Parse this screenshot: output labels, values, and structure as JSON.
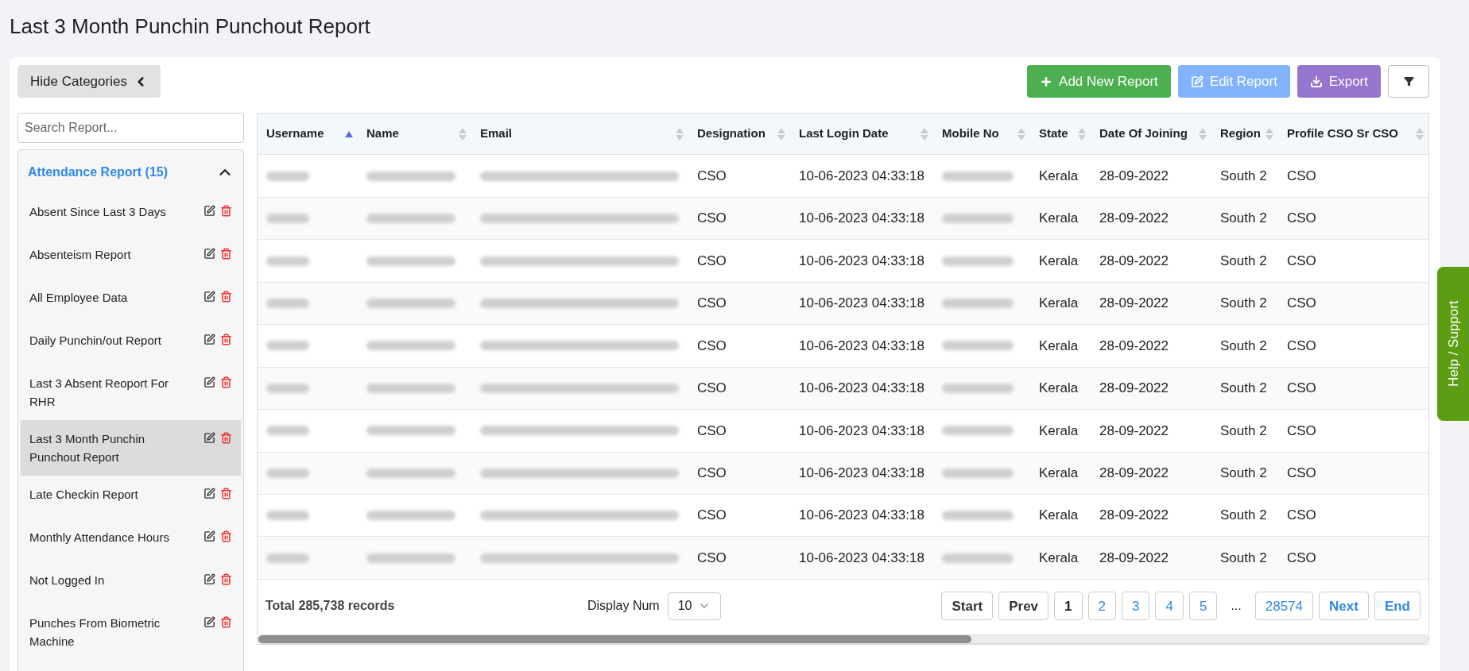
{
  "page_title": "Last 3 Month Punchin Punchout Report",
  "hide_categories_button": "Hide Categories",
  "toolbar": [
    {
      "kind": "add",
      "label": "Add New Report"
    },
    {
      "kind": "edit",
      "label": "Edit Report"
    },
    {
      "kind": "export",
      "label": "Export"
    },
    {
      "kind": "filter"
    }
  ],
  "sidebar": {
    "search_placeholder": "Search Report...",
    "category": {
      "title": "Attendance Report (15)",
      "expanded": true
    },
    "items": [
      {
        "label": "Absent Since Last 3 Days",
        "selected": false
      },
      {
        "label": "Absenteism Report",
        "selected": false
      },
      {
        "label": "All Employee Data",
        "selected": false
      },
      {
        "label": "Daily Punchin/out Report",
        "selected": false
      },
      {
        "label": "Last 3 Absent Reoport For RHR",
        "selected": false
      },
      {
        "label": "Last 3 Month Punchin Punchout Report",
        "selected": true
      },
      {
        "label": "Late Checkin Report",
        "selected": false
      },
      {
        "label": "Monthly Attendance Hours",
        "selected": false
      },
      {
        "label": "Not Logged In",
        "selected": false
      },
      {
        "label": "Punches From Biometric Machine",
        "selected": false
      }
    ]
  },
  "table": {
    "columns": [
      {
        "label": "Username",
        "sorted": true
      },
      {
        "label": "Name",
        "sorted": false
      },
      {
        "label": "Email",
        "sorted": false
      },
      {
        "label": "Designation",
        "sorted": false
      },
      {
        "label": "Last Login Date",
        "sorted": false
      },
      {
        "label": "Mobile No",
        "sorted": false
      },
      {
        "label": "State",
        "sorted": false
      },
      {
        "label": "Date Of Joining",
        "sorted": false
      },
      {
        "label": "Region",
        "sorted": false
      },
      {
        "label": "Profile CSO Sr CSO",
        "sorted": false
      }
    ],
    "rows": [
      {
        "cells": [
          {
            "kind": "blurred"
          },
          {
            "kind": "blurred"
          },
          {
            "kind": "blurred"
          },
          {
            "kind": "text",
            "text": "CSO"
          },
          {
            "kind": "text",
            "text": "10-06-2023 04:33:18"
          },
          {
            "kind": "blurred"
          },
          {
            "kind": "text",
            "text": "Kerala"
          },
          {
            "kind": "text",
            "text": "28-09-2022"
          },
          {
            "kind": "text",
            "text": "South 2"
          },
          {
            "kind": "text",
            "text": "CSO"
          }
        ]
      },
      {
        "cells": [
          {
            "kind": "blurred"
          },
          {
            "kind": "blurred"
          },
          {
            "kind": "blurred"
          },
          {
            "kind": "text",
            "text": "CSO"
          },
          {
            "kind": "text",
            "text": "10-06-2023 04:33:18"
          },
          {
            "kind": "blurred"
          },
          {
            "kind": "text",
            "text": "Kerala"
          },
          {
            "kind": "text",
            "text": "28-09-2022"
          },
          {
            "kind": "text",
            "text": "South 2"
          },
          {
            "kind": "text",
            "text": "CSO"
          }
        ]
      },
      {
        "cells": [
          {
            "kind": "blurred"
          },
          {
            "kind": "blurred"
          },
          {
            "kind": "blurred"
          },
          {
            "kind": "text",
            "text": "CSO"
          },
          {
            "kind": "text",
            "text": "10-06-2023 04:33:18"
          },
          {
            "kind": "blurred"
          },
          {
            "kind": "text",
            "text": "Kerala"
          },
          {
            "kind": "text",
            "text": "28-09-2022"
          },
          {
            "kind": "text",
            "text": "South 2"
          },
          {
            "kind": "text",
            "text": "CSO"
          }
        ]
      },
      {
        "cells": [
          {
            "kind": "blurred"
          },
          {
            "kind": "blurred"
          },
          {
            "kind": "blurred"
          },
          {
            "kind": "text",
            "text": "CSO"
          },
          {
            "kind": "text",
            "text": "10-06-2023 04:33:18"
          },
          {
            "kind": "blurred"
          },
          {
            "kind": "text",
            "text": "Kerala"
          },
          {
            "kind": "text",
            "text": "28-09-2022"
          },
          {
            "kind": "text",
            "text": "South 2"
          },
          {
            "kind": "text",
            "text": "CSO"
          }
        ]
      },
      {
        "cells": [
          {
            "kind": "blurred"
          },
          {
            "kind": "blurred"
          },
          {
            "kind": "blurred"
          },
          {
            "kind": "text",
            "text": "CSO"
          },
          {
            "kind": "text",
            "text": "10-06-2023 04:33:18"
          },
          {
            "kind": "blurred"
          },
          {
            "kind": "text",
            "text": "Kerala"
          },
          {
            "kind": "text",
            "text": "28-09-2022"
          },
          {
            "kind": "text",
            "text": "South 2"
          },
          {
            "kind": "text",
            "text": "CSO"
          }
        ]
      },
      {
        "cells": [
          {
            "kind": "blurred"
          },
          {
            "kind": "blurred"
          },
          {
            "kind": "blurred"
          },
          {
            "kind": "text",
            "text": "CSO"
          },
          {
            "kind": "text",
            "text": "10-06-2023 04:33:18"
          },
          {
            "kind": "blurred"
          },
          {
            "kind": "text",
            "text": "Kerala"
          },
          {
            "kind": "text",
            "text": "28-09-2022"
          },
          {
            "kind": "text",
            "text": "South 2"
          },
          {
            "kind": "text",
            "text": "CSO"
          }
        ]
      },
      {
        "cells": [
          {
            "kind": "blurred"
          },
          {
            "kind": "blurred"
          },
          {
            "kind": "blurred"
          },
          {
            "kind": "text",
            "text": "CSO"
          },
          {
            "kind": "text",
            "text": "10-06-2023 04:33:18"
          },
          {
            "kind": "blurred"
          },
          {
            "kind": "text",
            "text": "Kerala"
          },
          {
            "kind": "text",
            "text": "28-09-2022"
          },
          {
            "kind": "text",
            "text": "South 2"
          },
          {
            "kind": "text",
            "text": "CSO"
          }
        ]
      },
      {
        "cells": [
          {
            "kind": "blurred"
          },
          {
            "kind": "blurred"
          },
          {
            "kind": "blurred"
          },
          {
            "kind": "text",
            "text": "CSO"
          },
          {
            "kind": "text",
            "text": "10-06-2023 04:33:18"
          },
          {
            "kind": "blurred"
          },
          {
            "kind": "text",
            "text": "Kerala"
          },
          {
            "kind": "text",
            "text": "28-09-2022"
          },
          {
            "kind": "text",
            "text": "South 2"
          },
          {
            "kind": "text",
            "text": "CSO"
          }
        ]
      },
      {
        "cells": [
          {
            "kind": "blurred"
          },
          {
            "kind": "blurred"
          },
          {
            "kind": "blurred"
          },
          {
            "kind": "text",
            "text": "CSO"
          },
          {
            "kind": "text",
            "text": "10-06-2023 04:33:18"
          },
          {
            "kind": "blurred"
          },
          {
            "kind": "text",
            "text": "Kerala"
          },
          {
            "kind": "text",
            "text": "28-09-2022"
          },
          {
            "kind": "text",
            "text": "South 2"
          },
          {
            "kind": "text",
            "text": "CSO"
          }
        ]
      },
      {
        "cells": [
          {
            "kind": "blurred"
          },
          {
            "kind": "blurred"
          },
          {
            "kind": "blurred"
          },
          {
            "kind": "text",
            "text": "CSO"
          },
          {
            "kind": "text",
            "text": "10-06-2023 04:33:18"
          },
          {
            "kind": "blurred"
          },
          {
            "kind": "text",
            "text": "Kerala"
          },
          {
            "kind": "text",
            "text": "28-09-2022"
          },
          {
            "kind": "text",
            "text": "South 2"
          },
          {
            "kind": "text",
            "text": "CSO"
          }
        ]
      }
    ]
  },
  "footer": {
    "total": "Total 285,738 records",
    "display_label": "Display Num",
    "display_value": "10"
  },
  "pagination": [
    {
      "kind": "nav",
      "label": "Start",
      "disabled": true
    },
    {
      "kind": "nav",
      "label": "Prev",
      "disabled": true
    },
    {
      "kind": "page",
      "label": "1",
      "selected": true
    },
    {
      "kind": "page",
      "label": "2",
      "selected": false
    },
    {
      "kind": "page",
      "label": "3",
      "selected": false
    },
    {
      "kind": "page",
      "label": "4",
      "selected": false
    },
    {
      "kind": "page",
      "label": "5",
      "selected": false
    },
    {
      "kind": "ellipsis",
      "label": "..."
    },
    {
      "kind": "page",
      "label": "28574",
      "selected": false
    },
    {
      "kind": "nav",
      "label": "Next",
      "disabled": false
    },
    {
      "kind": "nav",
      "label": "End",
      "disabled": false
    }
  ],
  "help_tab": "Help / Support"
}
